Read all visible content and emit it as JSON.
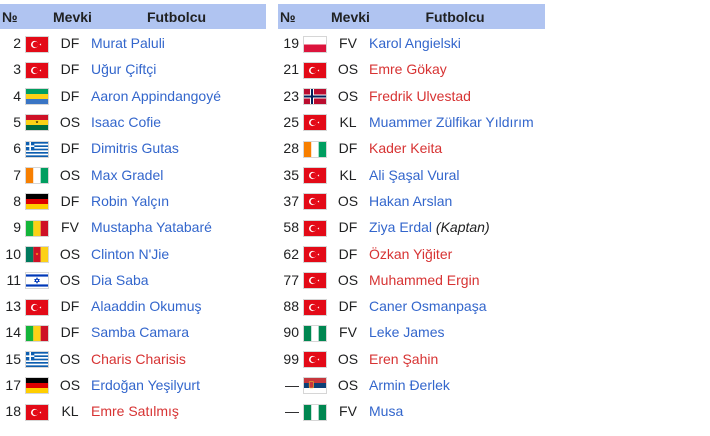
{
  "headers": {
    "number": "№",
    "position": "Mevki",
    "player": "Futbolcu"
  },
  "left": [
    {
      "no": "2",
      "flag": "TR",
      "pos": "DF",
      "name": "Murat Paluli",
      "link": "blue"
    },
    {
      "no": "3",
      "flag": "TR",
      "pos": "DF",
      "name": "Uğur Çiftçi",
      "link": "blue"
    },
    {
      "no": "4",
      "flag": "GA",
      "pos": "DF",
      "name": "Aaron Appindangoyé",
      "link": "blue"
    },
    {
      "no": "5",
      "flag": "GH",
      "pos": "OS",
      "name": "Isaac Cofie",
      "link": "blue"
    },
    {
      "no": "6",
      "flag": "GR",
      "pos": "DF",
      "name": "Dimitris Gutas",
      "link": "blue"
    },
    {
      "no": "7",
      "flag": "CI",
      "pos": "OS",
      "name": "Max Gradel",
      "link": "blue"
    },
    {
      "no": "8",
      "flag": "DE",
      "pos": "DF",
      "name": "Robin Yalçın",
      "link": "blue"
    },
    {
      "no": "9",
      "flag": "ML",
      "pos": "FV",
      "name": "Mustapha Yatabaré",
      "link": "blue"
    },
    {
      "no": "10",
      "flag": "CM",
      "pos": "OS",
      "name": "Clinton N'Jie",
      "link": "blue"
    },
    {
      "no": "11",
      "flag": "IL",
      "pos": "OS",
      "name": "Dia Saba",
      "link": "blue"
    },
    {
      "no": "13",
      "flag": "TR",
      "pos": "DF",
      "name": "Alaaddin Okumuş",
      "link": "blue"
    },
    {
      "no": "14",
      "flag": "ML",
      "pos": "DF",
      "name": "Samba Camara",
      "link": "blue"
    },
    {
      "no": "15",
      "flag": "GR",
      "pos": "OS",
      "name": "Charis Charisis",
      "link": "red"
    },
    {
      "no": "17",
      "flag": "DE",
      "pos": "OS",
      "name": "Erdoğan Yeşilyurt",
      "link": "blue"
    },
    {
      "no": "18",
      "flag": "TR",
      "pos": "KL",
      "name": "Emre Satılmış",
      "link": "red"
    }
  ],
  "right": [
    {
      "no": "19",
      "flag": "PL",
      "pos": "FV",
      "name": "Karol Angielski",
      "link": "blue"
    },
    {
      "no": "21",
      "flag": "TR",
      "pos": "OS",
      "name": "Emre Gökay",
      "link": "red"
    },
    {
      "no": "23",
      "flag": "NO",
      "pos": "OS",
      "name": "Fredrik Ulvestad",
      "link": "red"
    },
    {
      "no": "25",
      "flag": "TR",
      "pos": "KL",
      "name": "Muammer Zülfikar Yıldırım",
      "link": "blue"
    },
    {
      "no": "28",
      "flag": "CI",
      "pos": "DF",
      "name": "Kader Keita",
      "link": "red"
    },
    {
      "no": "35",
      "flag": "TR",
      "pos": "KL",
      "name": "Ali Şaşal Vural",
      "link": "blue"
    },
    {
      "no": "37",
      "flag": "TR",
      "pos": "OS",
      "name": "Hakan Arslan",
      "link": "blue"
    },
    {
      "no": "58",
      "flag": "TR",
      "pos": "DF",
      "name": "Ziya Erdal",
      "link": "blue",
      "note": "(Kaptan)"
    },
    {
      "no": "62",
      "flag": "TR",
      "pos": "DF",
      "name": "Özkan Yiğiter",
      "link": "red"
    },
    {
      "no": "77",
      "flag": "TR",
      "pos": "OS",
      "name": "Muhammed Ergin",
      "link": "red"
    },
    {
      "no": "88",
      "flag": "TR",
      "pos": "DF",
      "name": "Caner Osmanpaşa",
      "link": "blue"
    },
    {
      "no": "90",
      "flag": "NG",
      "pos": "FV",
      "name": "Leke James",
      "link": "blue"
    },
    {
      "no": "99",
      "flag": "TR",
      "pos": "OS",
      "name": "Eren Şahin",
      "link": "red"
    },
    {
      "no": "—",
      "flag": "RS",
      "pos": "OS",
      "name": "Armin Đerlek",
      "link": "blue"
    },
    {
      "no": "—",
      "flag": "NG",
      "pos": "FV",
      "name": "Musa",
      "link": "blue"
    }
  ],
  "colors": {
    "header_bg": "#b0c4f1",
    "link": "#3366cc",
    "missing_link": "#d73333",
    "text": "#202122"
  }
}
